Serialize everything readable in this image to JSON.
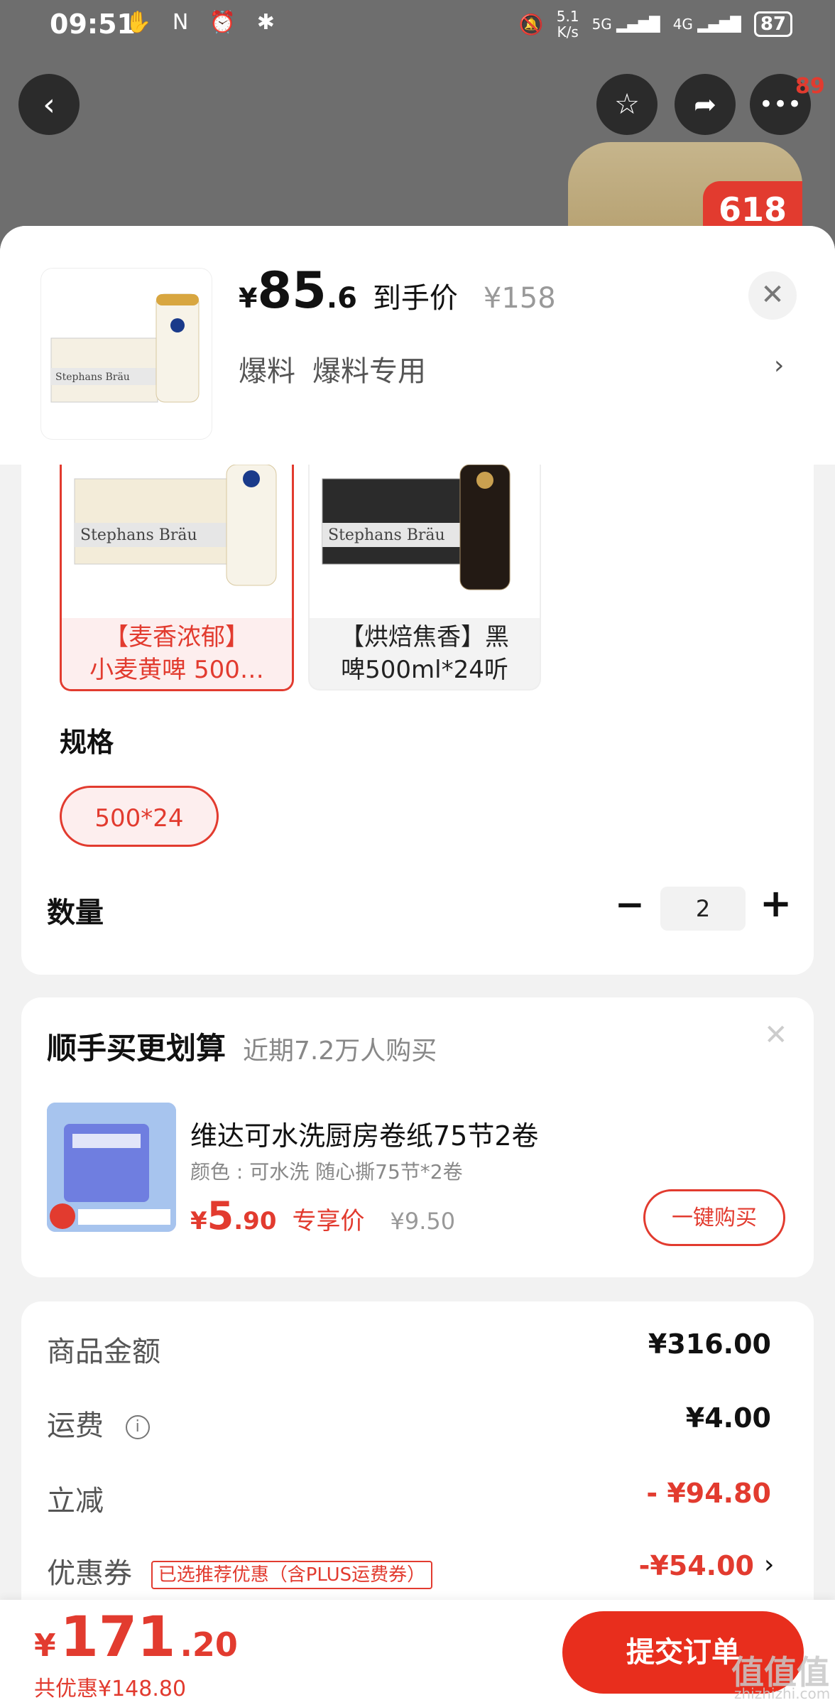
{
  "status_bar": {
    "time": "09:51",
    "left_icons": "✋ N ⏰ ✱",
    "net_speed_top": "5.1",
    "net_speed_bottom": "K/s",
    "signal_1": "5G",
    "signal_2": "4G",
    "battery": "87"
  },
  "top_nav": {
    "more_badge": "89",
    "promo_badge": "618"
  },
  "product": {
    "price_yen": "¥",
    "price_int": "85",
    "price_dec": ".6",
    "price_label": "到手价",
    "original_price": "¥158",
    "tag_1": "爆料",
    "tag_2": "爆料专用"
  },
  "variants": [
    {
      "label_line1": "【麦香浓郁】",
      "label_line2": "小麦黄啤 500…",
      "selected": true
    },
    {
      "label_line1": "【烘焙焦香】黑",
      "label_line2": "啤500ml*24听",
      "selected": false
    }
  ],
  "spec": {
    "title": "规格",
    "option": "500*24"
  },
  "quantity": {
    "title": "数量",
    "value": "2"
  },
  "upsell": {
    "title": "顺手买更划算",
    "subtitle": "近期7.2万人购买",
    "name": "维达可水洗厨房卷纸75节2卷",
    "attributes": "颜色 : 可水洗 随心撕75节*2卷",
    "price_yen": "¥",
    "price_int": "5",
    "price_dec": ".90",
    "price_label": "专享价",
    "original_price": "¥9.50",
    "button": "一键购买"
  },
  "summary": {
    "goods_label": "商品金额",
    "goods_value": "¥316.00",
    "shipping_label": "运费",
    "shipping_value": "¥4.00",
    "discount_label": "立减",
    "discount_value": "- ¥94.80",
    "coupon_label": "优惠券",
    "coupon_tag": "已选推荐优惠（含PLUS运费券）",
    "coupon_value": "-¥54.00"
  },
  "bottom": {
    "total_yen": "¥",
    "total_int": "171",
    "total_dec": ".20",
    "saving": "共优惠¥148.80",
    "submit": "提交订单"
  },
  "watermark": {
    "main": "值值值",
    "sub": "zhizhizhi.com"
  },
  "colors": {
    "accent": "#e23b2f",
    "submit_bg": "#e82e1d",
    "backdrop": "#6e6e6e"
  }
}
